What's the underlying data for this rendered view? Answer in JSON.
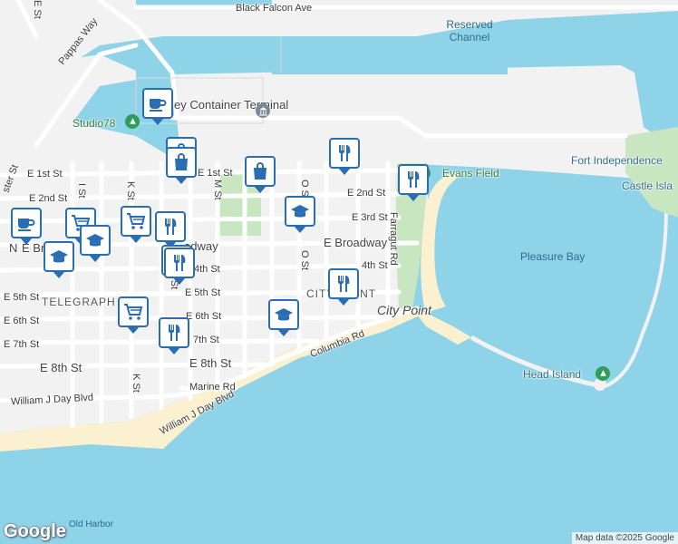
{
  "streets": {
    "black_falcon_ave": "Black Falcon Ave",
    "pappas_way": "Pappas Way",
    "e_1st_st_west": "E 1st St",
    "e_1st_st_east": "E 1st St",
    "e_2nd_st_west": "E 2nd St",
    "e_2nd_st_east": "E 2nd St",
    "e_3rd_st": "E 3rd St",
    "e_broadway_west": "E Br",
    "e_broadway_mid": "adway",
    "e_broadway_east": "E Broadway",
    "e_4th_st_west": "4th St",
    "e_4th_st_east": "4th St",
    "e_5th_st_west": "E 5th St",
    "e_5th_st_east": "E 5th St",
    "e_6th_st_west": "E 6th St",
    "e_6th_st_east": "E 6th St",
    "e_7th_st_west": "E 7th St",
    "e_7th_st_east": "7th St",
    "e_8th_st_west": "E 8th St",
    "e_8th_st_east": "E 8th St",
    "marine_rd": "Marine Rd",
    "columbia_rd": "Columbia Rd",
    "william_j_day_west": "William J Day Blvd",
    "william_j_day_east": "William J Day Blvd",
    "farragut_rd": "Farragut Rd",
    "m_st": "M St",
    "o_st_north": "O St",
    "o_st_south": "O St",
    "k_st_north": "K St",
    "k_st_south": "K St",
    "l_st": "L St",
    "i_st": "I St",
    "dorchester_st": "ster St",
    "e_st": "E St",
    "n_prefix": "N"
  },
  "places": {
    "studio78": "Studio78",
    "container_terminal": "ey Container Terminal",
    "evans_field": "Evans Field",
    "fort_independence": "Fort Independence",
    "castle_island": "Castle Isla",
    "head_island": "Head Island",
    "city_point": "City Point",
    "city_point_hood": "CITY POINT",
    "telegraph": "TELEGRAPH"
  },
  "water": {
    "reserved_channel": "Reserved Channel",
    "pleasure_bay": "Pleasure Bay",
    "old_harbor": "Old Harbor"
  },
  "footer": {
    "logo": "Google",
    "credit": "Map data ©2025 Google"
  },
  "pins": [
    {
      "icon": "cafe"
    },
    {
      "icon": "shopping"
    },
    {
      "icon": "shopping"
    },
    {
      "icon": "restaurant"
    },
    {
      "icon": "restaurant"
    },
    {
      "icon": "school"
    },
    {
      "icon": "cafe"
    },
    {
      "icon": "grocery"
    },
    {
      "icon": "grocery"
    },
    {
      "icon": "school"
    },
    {
      "icon": "school"
    },
    {
      "icon": "restaurant"
    },
    {
      "icon": "restaurant"
    },
    {
      "icon": "restaurant"
    },
    {
      "icon": "shopping"
    },
    {
      "icon": "school"
    },
    {
      "icon": "restaurant"
    },
    {
      "icon": "grocery"
    },
    {
      "icon": "restaurant"
    }
  ],
  "colors": {
    "water": "#8fd3e8",
    "land": "#f2f2f2",
    "park": "#c8e6c0",
    "pin_border": "#2a6db5",
    "beach": "#fbf0cf"
  }
}
